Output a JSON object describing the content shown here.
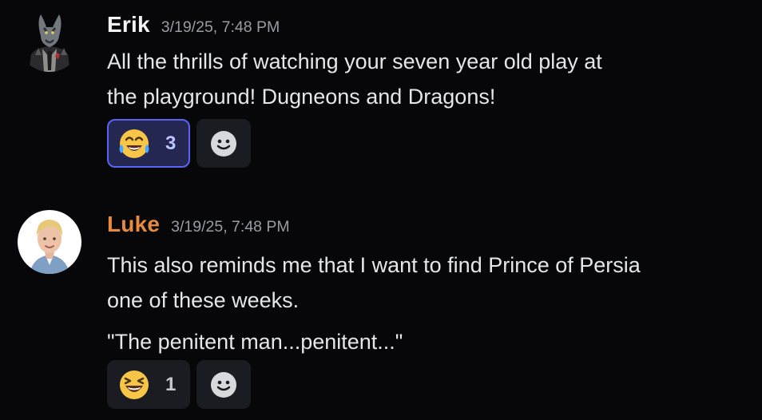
{
  "messages": [
    {
      "username": "Erik",
      "timestamp": "3/19/25, 7:48 PM",
      "lines": [
        "All the thrills of watching your seven year old play at",
        "the playground! Dugneons and Dragons!"
      ],
      "reaction": {
        "emoji": "face-with-tears-of-joy-icon",
        "count": "3",
        "active": true,
        "active_color": "#5864f2"
      },
      "add_reaction_icon": "smile-add-reaction-icon"
    },
    {
      "username": "Luke",
      "timestamp": "3/19/25, 7:48 PM",
      "lines": [
        "This also reminds me that I want to find Prince of Persia",
        "one of these weeks.",
        "\"The penitent man...penitent...\""
      ],
      "reaction": {
        "emoji": "grinning-squinting-face-icon",
        "count": "1",
        "active": false
      },
      "add_reaction_icon": "smile-add-reaction-icon"
    }
  ],
  "colors": {
    "background": "#070709",
    "username_luke": "#e78a3f",
    "username_erik": "#f2f3f5",
    "timestamp": "#9a9ca4"
  }
}
